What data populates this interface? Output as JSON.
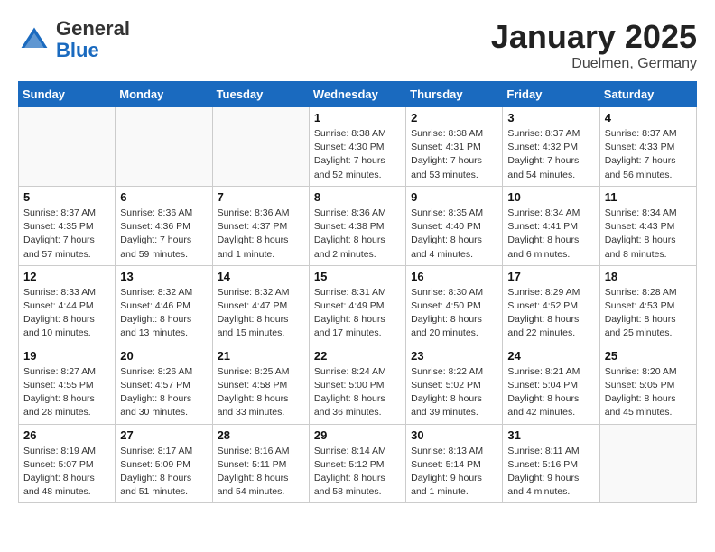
{
  "header": {
    "logo_general": "General",
    "logo_blue": "Blue",
    "month_title": "January 2025",
    "location": "Duelmen, Germany"
  },
  "days_of_week": [
    "Sunday",
    "Monday",
    "Tuesday",
    "Wednesday",
    "Thursday",
    "Friday",
    "Saturday"
  ],
  "weeks": [
    [
      {
        "day": "",
        "info": ""
      },
      {
        "day": "",
        "info": ""
      },
      {
        "day": "",
        "info": ""
      },
      {
        "day": "1",
        "info": "Sunrise: 8:38 AM\nSunset: 4:30 PM\nDaylight: 7 hours and 52 minutes."
      },
      {
        "day": "2",
        "info": "Sunrise: 8:38 AM\nSunset: 4:31 PM\nDaylight: 7 hours and 53 minutes."
      },
      {
        "day": "3",
        "info": "Sunrise: 8:37 AM\nSunset: 4:32 PM\nDaylight: 7 hours and 54 minutes."
      },
      {
        "day": "4",
        "info": "Sunrise: 8:37 AM\nSunset: 4:33 PM\nDaylight: 7 hours and 56 minutes."
      }
    ],
    [
      {
        "day": "5",
        "info": "Sunrise: 8:37 AM\nSunset: 4:35 PM\nDaylight: 7 hours and 57 minutes."
      },
      {
        "day": "6",
        "info": "Sunrise: 8:36 AM\nSunset: 4:36 PM\nDaylight: 7 hours and 59 minutes."
      },
      {
        "day": "7",
        "info": "Sunrise: 8:36 AM\nSunset: 4:37 PM\nDaylight: 8 hours and 1 minute."
      },
      {
        "day": "8",
        "info": "Sunrise: 8:36 AM\nSunset: 4:38 PM\nDaylight: 8 hours and 2 minutes."
      },
      {
        "day": "9",
        "info": "Sunrise: 8:35 AM\nSunset: 4:40 PM\nDaylight: 8 hours and 4 minutes."
      },
      {
        "day": "10",
        "info": "Sunrise: 8:34 AM\nSunset: 4:41 PM\nDaylight: 8 hours and 6 minutes."
      },
      {
        "day": "11",
        "info": "Sunrise: 8:34 AM\nSunset: 4:43 PM\nDaylight: 8 hours and 8 minutes."
      }
    ],
    [
      {
        "day": "12",
        "info": "Sunrise: 8:33 AM\nSunset: 4:44 PM\nDaylight: 8 hours and 10 minutes."
      },
      {
        "day": "13",
        "info": "Sunrise: 8:32 AM\nSunset: 4:46 PM\nDaylight: 8 hours and 13 minutes."
      },
      {
        "day": "14",
        "info": "Sunrise: 8:32 AM\nSunset: 4:47 PM\nDaylight: 8 hours and 15 minutes."
      },
      {
        "day": "15",
        "info": "Sunrise: 8:31 AM\nSunset: 4:49 PM\nDaylight: 8 hours and 17 minutes."
      },
      {
        "day": "16",
        "info": "Sunrise: 8:30 AM\nSunset: 4:50 PM\nDaylight: 8 hours and 20 minutes."
      },
      {
        "day": "17",
        "info": "Sunrise: 8:29 AM\nSunset: 4:52 PM\nDaylight: 8 hours and 22 minutes."
      },
      {
        "day": "18",
        "info": "Sunrise: 8:28 AM\nSunset: 4:53 PM\nDaylight: 8 hours and 25 minutes."
      }
    ],
    [
      {
        "day": "19",
        "info": "Sunrise: 8:27 AM\nSunset: 4:55 PM\nDaylight: 8 hours and 28 minutes."
      },
      {
        "day": "20",
        "info": "Sunrise: 8:26 AM\nSunset: 4:57 PM\nDaylight: 8 hours and 30 minutes."
      },
      {
        "day": "21",
        "info": "Sunrise: 8:25 AM\nSunset: 4:58 PM\nDaylight: 8 hours and 33 minutes."
      },
      {
        "day": "22",
        "info": "Sunrise: 8:24 AM\nSunset: 5:00 PM\nDaylight: 8 hours and 36 minutes."
      },
      {
        "day": "23",
        "info": "Sunrise: 8:22 AM\nSunset: 5:02 PM\nDaylight: 8 hours and 39 minutes."
      },
      {
        "day": "24",
        "info": "Sunrise: 8:21 AM\nSunset: 5:04 PM\nDaylight: 8 hours and 42 minutes."
      },
      {
        "day": "25",
        "info": "Sunrise: 8:20 AM\nSunset: 5:05 PM\nDaylight: 8 hours and 45 minutes."
      }
    ],
    [
      {
        "day": "26",
        "info": "Sunrise: 8:19 AM\nSunset: 5:07 PM\nDaylight: 8 hours and 48 minutes."
      },
      {
        "day": "27",
        "info": "Sunrise: 8:17 AM\nSunset: 5:09 PM\nDaylight: 8 hours and 51 minutes."
      },
      {
        "day": "28",
        "info": "Sunrise: 8:16 AM\nSunset: 5:11 PM\nDaylight: 8 hours and 54 minutes."
      },
      {
        "day": "29",
        "info": "Sunrise: 8:14 AM\nSunset: 5:12 PM\nDaylight: 8 hours and 58 minutes."
      },
      {
        "day": "30",
        "info": "Sunrise: 8:13 AM\nSunset: 5:14 PM\nDaylight: 9 hours and 1 minute."
      },
      {
        "day": "31",
        "info": "Sunrise: 8:11 AM\nSunset: 5:16 PM\nDaylight: 9 hours and 4 minutes."
      },
      {
        "day": "",
        "info": ""
      }
    ]
  ]
}
